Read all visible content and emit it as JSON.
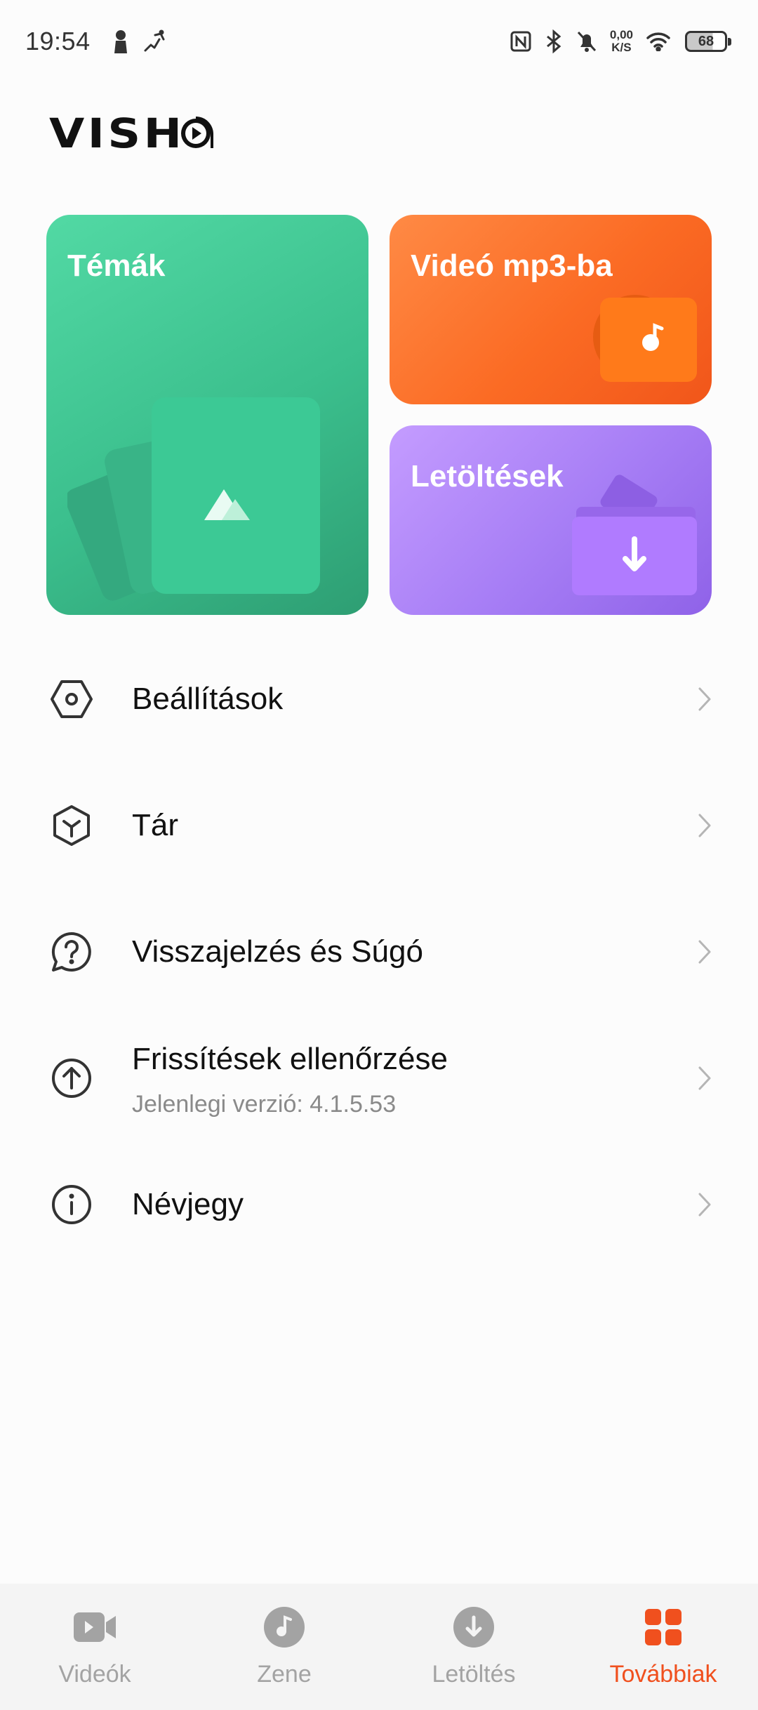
{
  "status_bar": {
    "time": "19:54",
    "net_speed_value": "0,00",
    "net_speed_unit": "K/S",
    "battery_level": "68",
    "icons": [
      "person-icon",
      "activity-icon",
      "nfc-icon",
      "bluetooth-icon",
      "bell-off-icon",
      "wifi-icon",
      "battery-icon"
    ]
  },
  "app": {
    "logo_text": "VISH"
  },
  "cards": {
    "themes": {
      "title": "Témák",
      "color": "#3bbf8d"
    },
    "video_to_mp3": {
      "title": "Videó mp3-ba",
      "color": "#fb6b24"
    },
    "downloads": {
      "title": "Letöltések",
      "color": "#a67df5"
    }
  },
  "menu": {
    "items": [
      {
        "label": "Beállítások",
        "icon": "settings-hex-icon"
      },
      {
        "label": "Tár",
        "icon": "storage-cube-icon"
      },
      {
        "label": "Visszajelzés és Súgó",
        "icon": "help-bubble-icon"
      },
      {
        "label": "Frissítések ellenőrzése",
        "sublabel": "Jelenlegi verzió: 4.1.5.53",
        "icon": "update-arrow-icon"
      },
      {
        "label": "Névjegy",
        "icon": "info-icon"
      }
    ]
  },
  "bottom_nav": {
    "items": [
      {
        "label": "Videók",
        "icon": "video-camera-icon",
        "active": false
      },
      {
        "label": "Zene",
        "icon": "music-disc-icon",
        "active": false
      },
      {
        "label": "Letöltés",
        "icon": "download-circle-icon",
        "active": false
      },
      {
        "label": "Továbbiak",
        "icon": "grid-icon",
        "active": true
      }
    ],
    "active_color": "#f0501e",
    "inactive_color": "#a3a3a3"
  }
}
